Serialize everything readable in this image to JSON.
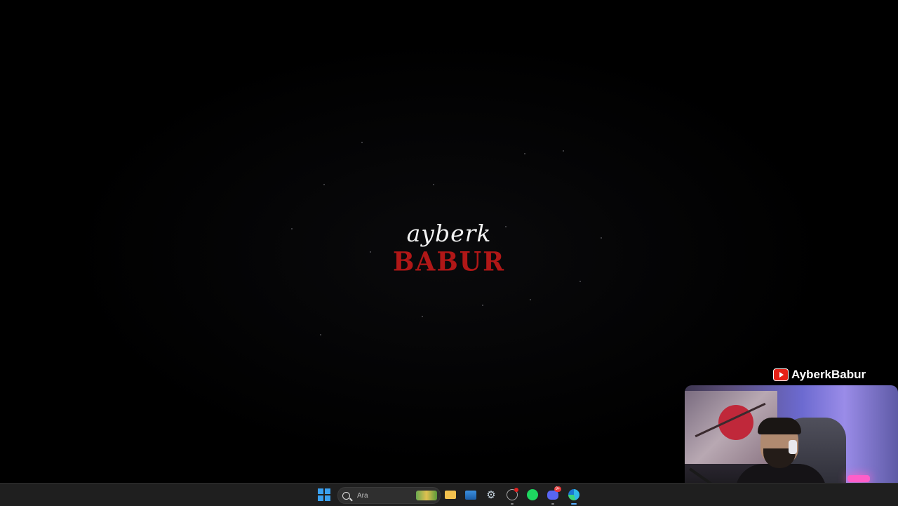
{
  "wallpaper": {
    "logo_top": "ayberk",
    "logo_bottom": "BABUR",
    "logo_top_color": "#f2f2f2",
    "logo_bottom_color": "#b01717"
  },
  "overlay": {
    "channel_icon": "youtube-icon",
    "channel_name": "AyberkBabur"
  },
  "taskbar": {
    "start_icon": "windows-start-icon",
    "search_placeholder": "Ara",
    "search_icon": "search-icon",
    "apps": [
      {
        "name": "file-explorer",
        "icon": "folder-icon"
      },
      {
        "name": "photos",
        "icon": "photos-icon"
      },
      {
        "name": "steam",
        "icon": "steam-icon"
      },
      {
        "name": "app",
        "icon": "clock-icon"
      },
      {
        "name": "spotify",
        "icon": "spotify-icon"
      },
      {
        "name": "discord",
        "icon": "discord-icon",
        "badge": "9+"
      },
      {
        "name": "microsoft-edge",
        "icon": "edge-icon",
        "active": true
      }
    ],
    "accent": "#58b0ff"
  }
}
